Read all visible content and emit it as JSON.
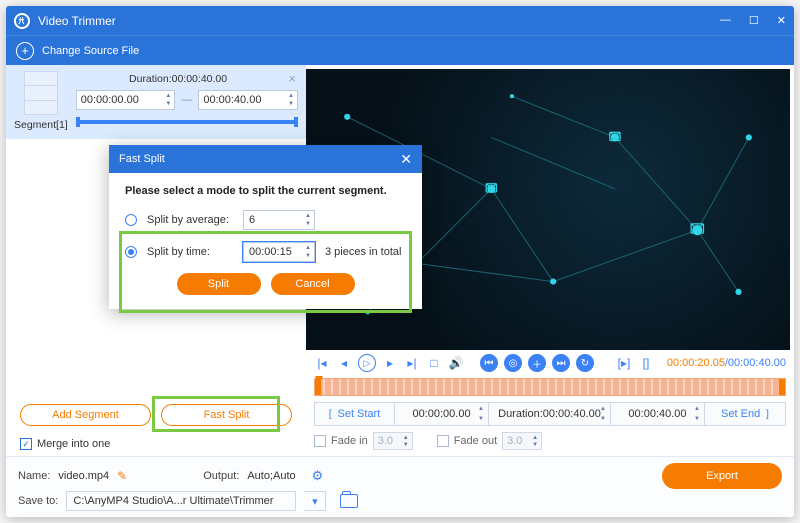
{
  "app": {
    "title": "Video Trimmer"
  },
  "toolbar": {
    "change_source": "Change Source File"
  },
  "segment": {
    "label": "Segment[1]",
    "duration_label": "Duration:00:00:40.00",
    "start": "00:00:00.00",
    "end": "00:00:40.00"
  },
  "dialog": {
    "title": "Fast Split",
    "message": "Please select a mode to split the current segment.",
    "split_by_average_label": "Split by average:",
    "split_by_average_value": "6",
    "split_by_time_label": "Split by time:",
    "split_by_time_value": "00:00:15",
    "pieces_text": "3  pieces in total",
    "split_btn": "Split",
    "cancel_btn": "Cancel"
  },
  "left_buttons": {
    "add_segment": "Add Segment",
    "fast_split": "Fast Split"
  },
  "merge_label": "Merge into one",
  "controls": {
    "current_time": "00:00:20.05",
    "total_time": "00:00:40.00"
  },
  "markers": {
    "set_start": "Set Start",
    "start": "00:00:00.00",
    "duration": "Duration:00:00:40.00",
    "end": "00:00:40.00",
    "set_end": "Set End"
  },
  "fade": {
    "in_label": "Fade in",
    "in_value": "3.0",
    "out_label": "Fade out",
    "out_value": "3.0"
  },
  "footer": {
    "name_label": "Name:",
    "name_value": "video.mp4",
    "output_label": "Output:",
    "output_value": "Auto;Auto",
    "save_label": "Save to:",
    "save_path": "C:\\AnyMP4 Studio\\A...r Ultimate\\Trimmer",
    "export": "Export"
  }
}
